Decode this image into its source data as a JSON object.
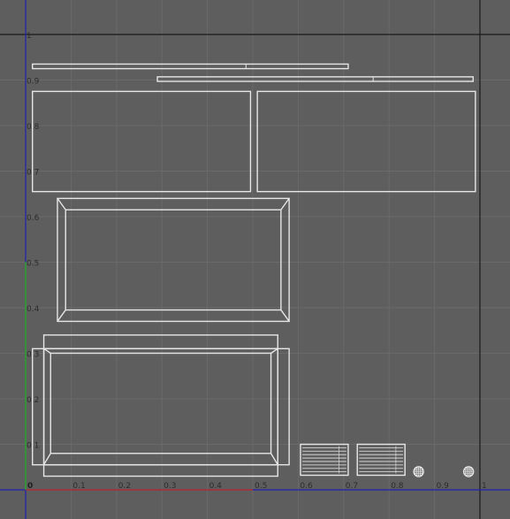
{
  "viewport": {
    "name": "UV Editor",
    "background": "#5e5e5e",
    "grid_color": "#6a6a6a",
    "uv_boundary_color": "#1a1a1a"
  },
  "axes": {
    "u_axis_color": "#b03030",
    "v_axis_color": "#30a030",
    "outer_axis_color": "#2020b0",
    "u_ticks": [
      {
        "value": 0,
        "label": "0"
      },
      {
        "value": 0.1,
        "label": "0.1"
      },
      {
        "value": 0.2,
        "label": "0.2"
      },
      {
        "value": 0.3,
        "label": "0.3"
      },
      {
        "value": 0.4,
        "label": "0.4"
      },
      {
        "value": 0.5,
        "label": "0.5"
      },
      {
        "value": 0.6,
        "label": "0.6"
      },
      {
        "value": 0.7,
        "label": "0.7"
      },
      {
        "value": 0.8,
        "label": "0.8"
      },
      {
        "value": 0.9,
        "label": "0.9"
      },
      {
        "value": 1,
        "label": "1"
      }
    ],
    "v_ticks": [
      {
        "value": 0.1,
        "label": "0.1"
      },
      {
        "value": 0.2,
        "label": "0.2"
      },
      {
        "value": 0.3,
        "label": "0.3"
      },
      {
        "value": 0.4,
        "label": "0.4"
      },
      {
        "value": 0.5,
        "label": "0.5"
      },
      {
        "value": 0.6,
        "label": "0.6"
      },
      {
        "value": 0.7,
        "label": "0.7"
      },
      {
        "value": 0.8,
        "label": "0.8"
      },
      {
        "value": 0.9,
        "label": "0.9"
      },
      {
        "value": 1,
        "label": "1"
      }
    ]
  },
  "uv_islands": {
    "wire_color": "#e6e6e6",
    "strips": [
      {
        "id": "strip-upper",
        "u0": 0.015,
        "v0": 0.925,
        "u1": 0.71,
        "v1": 0.935,
        "split": 0.485
      },
      {
        "id": "strip-lower",
        "u0": 0.29,
        "v0": 0.897,
        "u1": 0.985,
        "v1": 0.907,
        "split": 0.765
      }
    ],
    "panels": [
      {
        "id": "panel-left",
        "u0": 0.015,
        "v0": 0.655,
        "u1": 0.495,
        "v1": 0.875
      },
      {
        "id": "panel-right",
        "u0": 0.51,
        "v0": 0.655,
        "u1": 0.99,
        "v1": 0.875
      }
    ],
    "frames": [
      {
        "id": "frame-middle",
        "u0": 0.07,
        "v0": 0.37,
        "u1": 0.58,
        "v1": 0.64,
        "inset_u": 0.018,
        "inset_v": 0.025
      }
    ],
    "boxes": [
      {
        "id": "box-bottom",
        "top_flap": {
          "u0": 0.04,
          "v0": 0.31,
          "u1": 0.555,
          "v1": 0.34
        },
        "bottom_flap": {
          "u0": 0.04,
          "v0": 0.03,
          "u1": 0.555,
          "v1": 0.055
        },
        "left_flap": {
          "u0": 0.015,
          "v0": 0.055,
          "u1": 0.04,
          "v1": 0.31
        },
        "right_flap": {
          "u0": 0.555,
          "v0": 0.055,
          "u1": 0.58,
          "v1": 0.31
        },
        "outer": {
          "u0": 0.04,
          "v0": 0.055,
          "u1": 0.555,
          "v1": 0.31
        },
        "inner": {
          "u0": 0.055,
          "v0": 0.08,
          "u1": 0.54,
          "v1": 0.3
        }
      }
    ],
    "grilles": [
      {
        "id": "grille-1",
        "u0": 0.605,
        "v0": 0.032,
        "u1": 0.71,
        "v1": 0.1,
        "slats": 9
      },
      {
        "id": "grille-2",
        "u0": 0.73,
        "v0": 0.032,
        "u1": 0.835,
        "v1": 0.1,
        "slats": 9
      }
    ],
    "buttons": [
      {
        "id": "round-1",
        "u": 0.865,
        "v": 0.04,
        "r": 0.011
      },
      {
        "id": "round-2",
        "u": 0.975,
        "v": 0.04,
        "r": 0.011
      }
    ]
  }
}
